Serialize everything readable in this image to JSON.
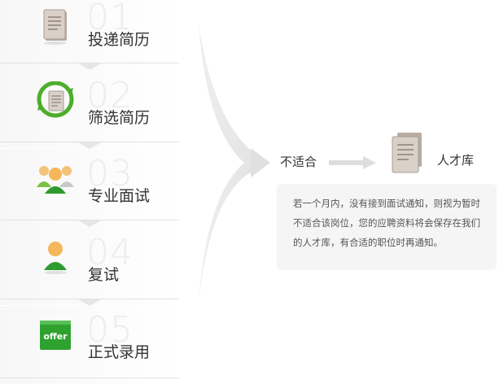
{
  "steps": [
    {
      "num": "01",
      "label": "投递简历",
      "icon": "resume-icon"
    },
    {
      "num": "02",
      "label": "筛选简历",
      "icon": "screening-icon"
    },
    {
      "num": "03",
      "label": "专业面试",
      "icon": "group-interview-icon"
    },
    {
      "num": "04",
      "label": "复试",
      "icon": "person-icon"
    },
    {
      "num": "05",
      "label": "正式录用",
      "icon": "offer-icon",
      "badge": "offer"
    }
  ],
  "unfit_label": "不适合",
  "talent_pool_label": "人才库",
  "note": "若一个月内，没有接到面试通知，则视为暂时不适合该岗位，您的应聘资料将会保存在我们的人才库，有合适的职位时再通知。"
}
